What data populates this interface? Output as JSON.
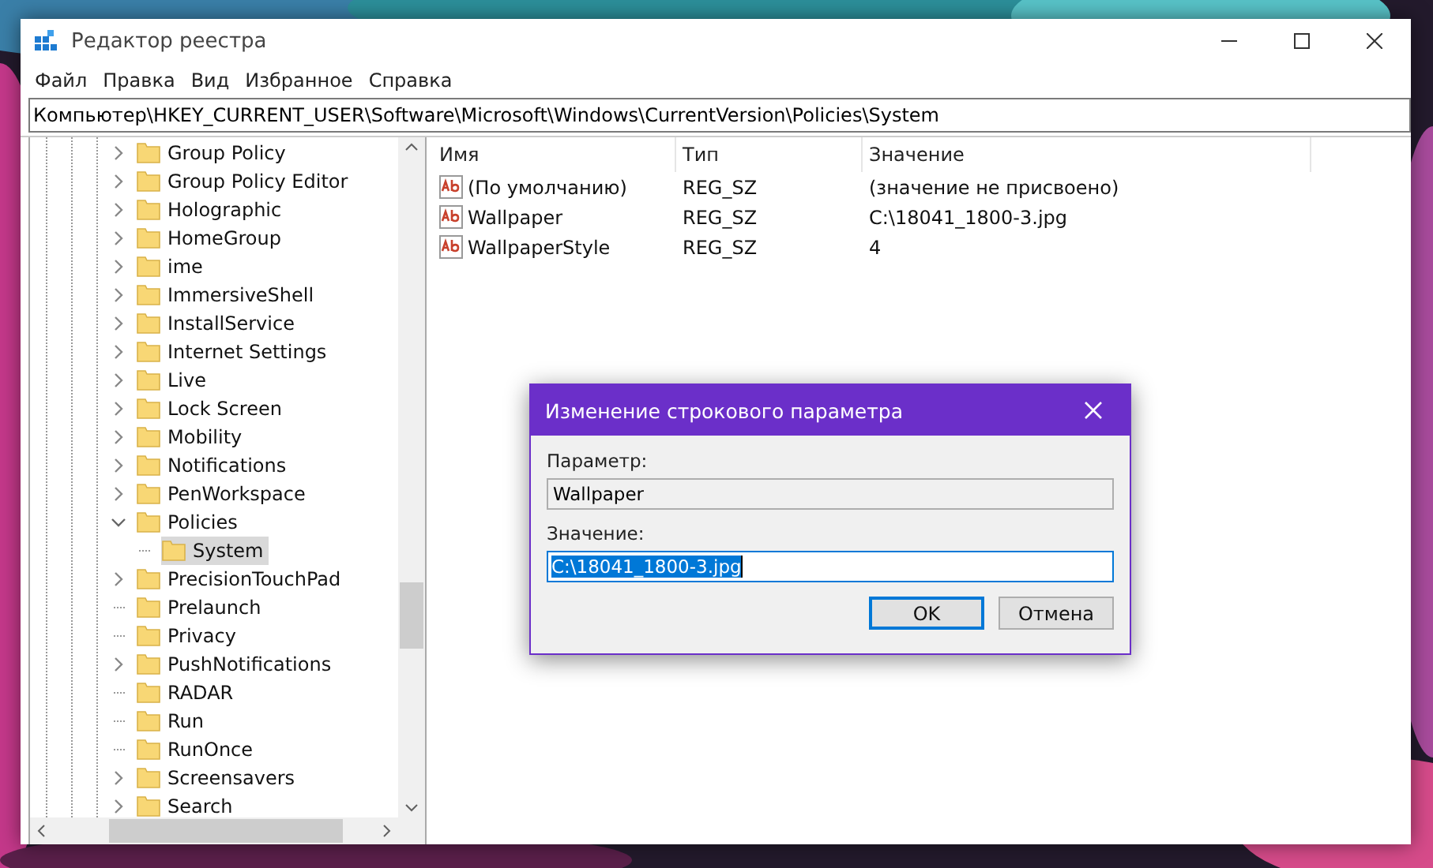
{
  "window": {
    "title": "Редактор реестра"
  },
  "menu": [
    "Файл",
    "Правка",
    "Вид",
    "Избранное",
    "Справка"
  ],
  "address": "Компьютер\\HKEY_CURRENT_USER\\Software\\Microsoft\\Windows\\CurrentVersion\\Policies\\System",
  "tree": [
    {
      "label": "Group Policy",
      "has_children": true,
      "expanded": false,
      "selected": false
    },
    {
      "label": "Group Policy Editor",
      "has_children": true,
      "expanded": false,
      "selected": false
    },
    {
      "label": "Holographic",
      "has_children": true,
      "expanded": false,
      "selected": false
    },
    {
      "label": "HomeGroup",
      "has_children": true,
      "expanded": false,
      "selected": false
    },
    {
      "label": "ime",
      "has_children": true,
      "expanded": false,
      "selected": false
    },
    {
      "label": "ImmersiveShell",
      "has_children": true,
      "expanded": false,
      "selected": false
    },
    {
      "label": "InstallService",
      "has_children": true,
      "expanded": false,
      "selected": false
    },
    {
      "label": "Internet Settings",
      "has_children": true,
      "expanded": false,
      "selected": false
    },
    {
      "label": "Live",
      "has_children": true,
      "expanded": false,
      "selected": false
    },
    {
      "label": "Lock Screen",
      "has_children": true,
      "expanded": false,
      "selected": false
    },
    {
      "label": "Mobility",
      "has_children": true,
      "expanded": false,
      "selected": false
    },
    {
      "label": "Notifications",
      "has_children": true,
      "expanded": false,
      "selected": false
    },
    {
      "label": "PenWorkspace",
      "has_children": true,
      "expanded": false,
      "selected": false
    },
    {
      "label": "Policies",
      "has_children": true,
      "expanded": true,
      "selected": false,
      "children": [
        {
          "label": "System",
          "has_children": false,
          "selected": true
        }
      ]
    },
    {
      "label": "PrecisionTouchPad",
      "has_children": true,
      "expanded": false,
      "selected": false
    },
    {
      "label": "Prelaunch",
      "has_children": false,
      "selected": false
    },
    {
      "label": "Privacy",
      "has_children": false,
      "selected": false
    },
    {
      "label": "PushNotifications",
      "has_children": true,
      "expanded": false,
      "selected": false
    },
    {
      "label": "RADAR",
      "has_children": false,
      "selected": false
    },
    {
      "label": "Run",
      "has_children": false,
      "selected": false
    },
    {
      "label": "RunOnce",
      "has_children": false,
      "selected": false
    },
    {
      "label": "Screensavers",
      "has_children": true,
      "expanded": false,
      "selected": false
    },
    {
      "label": "Search",
      "has_children": true,
      "expanded": false,
      "selected": false
    }
  ],
  "table": {
    "columns": [
      "Имя",
      "Тип",
      "Значение"
    ],
    "rows": [
      {
        "name": "(По умолчанию)",
        "type": "REG_SZ",
        "value": "(значение не присвоено)"
      },
      {
        "name": "Wallpaper",
        "type": "REG_SZ",
        "value": "C:\\18041_1800-3.jpg"
      },
      {
        "name": "WallpaperStyle",
        "type": "REG_SZ",
        "value": "4"
      }
    ]
  },
  "dialog": {
    "title": "Изменение строкового параметра",
    "name_label": "Параметр:",
    "name_value": "Wallpaper",
    "value_label": "Значение:",
    "value": "C:\\18041_1800-3.jpg",
    "value_selected": true,
    "buttons": [
      {
        "label": "OK",
        "focused": true
      },
      {
        "label": "Отмена",
        "focused": false
      }
    ]
  }
}
